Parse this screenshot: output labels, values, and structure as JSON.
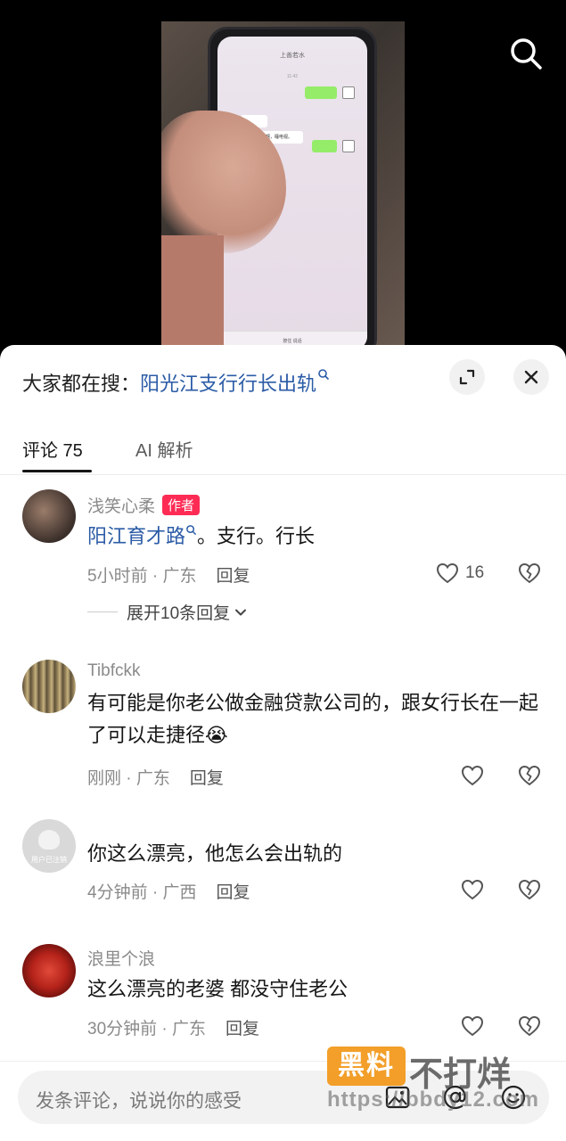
{
  "search": {
    "icon": "search-icon"
  },
  "video": {
    "phone_title": "上善若水",
    "phone_time": "11:42",
    "phone_msg": "你老婆出去啊，睡电视。",
    "phone_input": "按住 说话"
  },
  "sheet": {
    "trend_prefix": "大家都在搜：",
    "trend_link": "阳光江支行行长出轨",
    "expand_icon": "expand-icon",
    "close_icon": "close-icon"
  },
  "tabs": [
    {
      "label": "评论 75",
      "active": true
    },
    {
      "label": "AI 解析",
      "active": false
    }
  ],
  "comments": [
    {
      "username": "浅笑心柔",
      "author_tag": "作者",
      "text_link": "阳江育才路",
      "text_rest": "。支行。行长",
      "time_location": "5小时前 · 广东",
      "reply": "回复",
      "likes": "16",
      "expand_replies": "展开10条回复"
    },
    {
      "username": "Tibfckk",
      "text": "有可能是你老公做金融贷款公司的，跟女行长在一起了可以走捷径😭",
      "time_location": "刚刚 · 广东",
      "reply": "回复"
    },
    {
      "username": "",
      "avatar_label": "用户已注销",
      "text": "你这么漂亮，他怎么会出轨的",
      "time_location": "4分钟前 · 广西",
      "reply": "回复"
    },
    {
      "username": "浪里个浪",
      "text": "这么漂亮的老婆   都没守住老公",
      "time_location": "30分钟前 · 广东",
      "reply": "回复"
    }
  ],
  "input": {
    "placeholder": "发条评论，说说你的感受",
    "icons": [
      "image-icon",
      "at-icon",
      "emoji-icon"
    ]
  },
  "watermark": {
    "box": "黑料",
    "text": "不打烊",
    "url": "https://bbdy12.com"
  },
  "colors": {
    "link": "#2b5ba6",
    "author_tag": "#fe2c55",
    "watermark": "#f39a1f"
  }
}
